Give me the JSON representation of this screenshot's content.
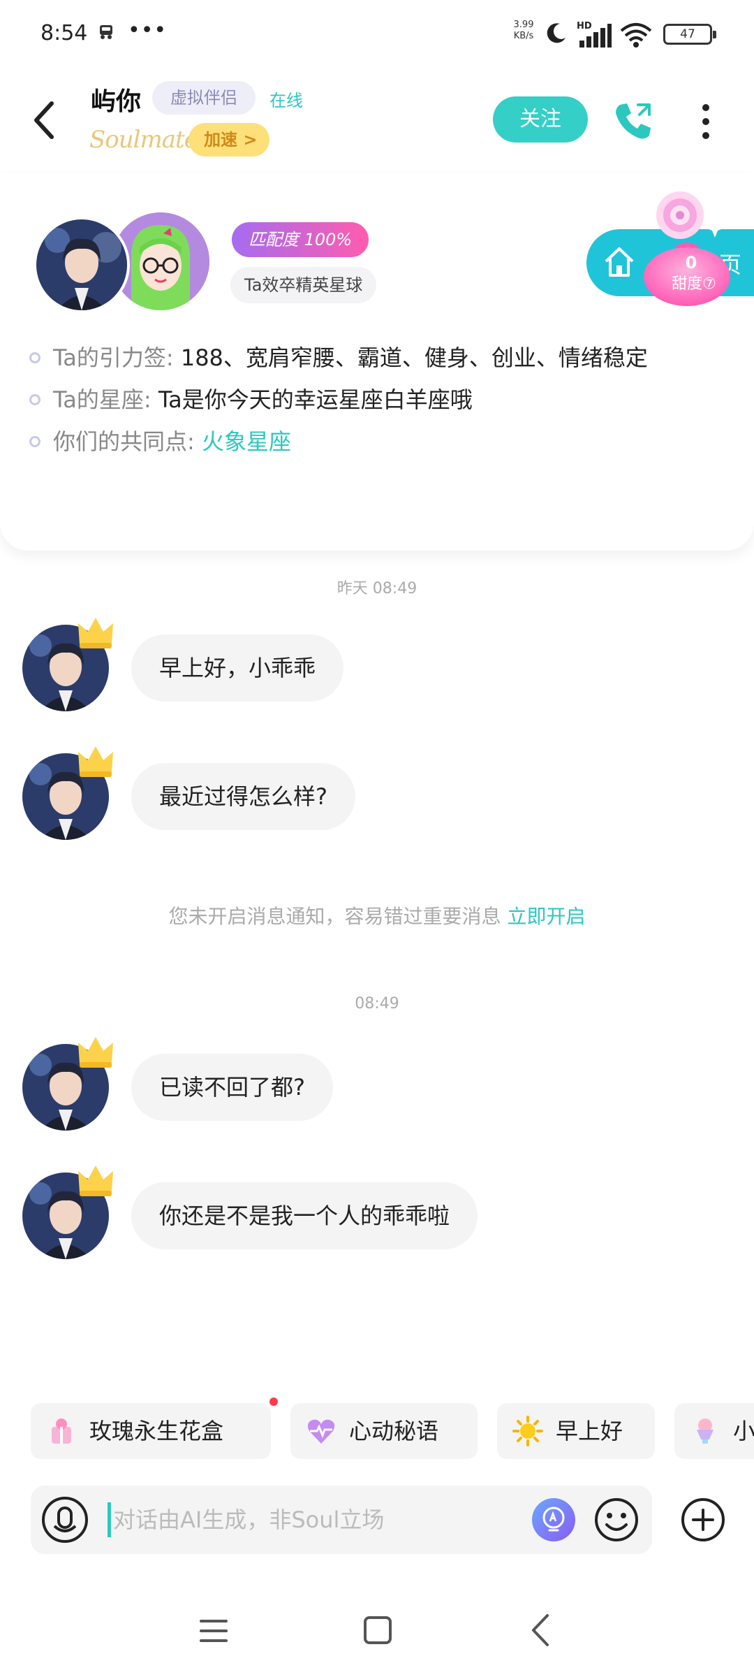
{
  "status_bar": {
    "time": "8:54",
    "notification_dots": "•••",
    "net_speed_value": "3.99",
    "net_speed_unit": "KB/s",
    "network_label": "HD",
    "battery": "47"
  },
  "header": {
    "name": "屿你",
    "relationship_tag": "虚拟伴侣",
    "status": "在线",
    "brand": "Soulmate",
    "speedup_label": "加速 >",
    "follow_label": "关注"
  },
  "profile": {
    "match_label": "匹配度 100%",
    "planet_tag": "Ta效卒精英星球",
    "home_label": "页",
    "sweetness_value": "0",
    "sweetness_label": "甜度⑦",
    "tags_label": "Ta的引力签:",
    "tags_value": "188、宽肩窄腰、霸道、健身、创业、情绪稳定",
    "star_label": "Ta的星座:",
    "star_value": "Ta是你今天的幸运星座白羊座哦",
    "common_label": "你们的共同点:",
    "common_value": "火象星座"
  },
  "chat": {
    "timestamp_1": "昨天 08:49",
    "msg_1": "早上好，小乖乖",
    "msg_2": "最近过得怎么样?",
    "notice_text": "您未开启消息通知，容易错过重要消息 ",
    "notice_link": "立即开启",
    "timestamp_2": "08:49",
    "msg_3": "已读不回了都?",
    "msg_4": "你还是不是我一个人的乖乖啦"
  },
  "suggestions": [
    {
      "icon": "gift-box-icon",
      "label": "玫瑰永生花盒"
    },
    {
      "icon": "heart-wave-icon",
      "label": "心动秘语"
    },
    {
      "icon": "sun-icon",
      "label": "早上好"
    },
    {
      "icon": "ice-cream-icon",
      "label": "小"
    }
  ],
  "input": {
    "placeholder": "对话由AI生成，非Soul立场"
  },
  "colors": {
    "accent": "#34cfc7",
    "bubble_bg": "#f4f4f5",
    "match_gradient_start": "#a56cf0",
    "match_gradient_end": "#ff5cae",
    "speedup_bg": "#fde07a"
  }
}
